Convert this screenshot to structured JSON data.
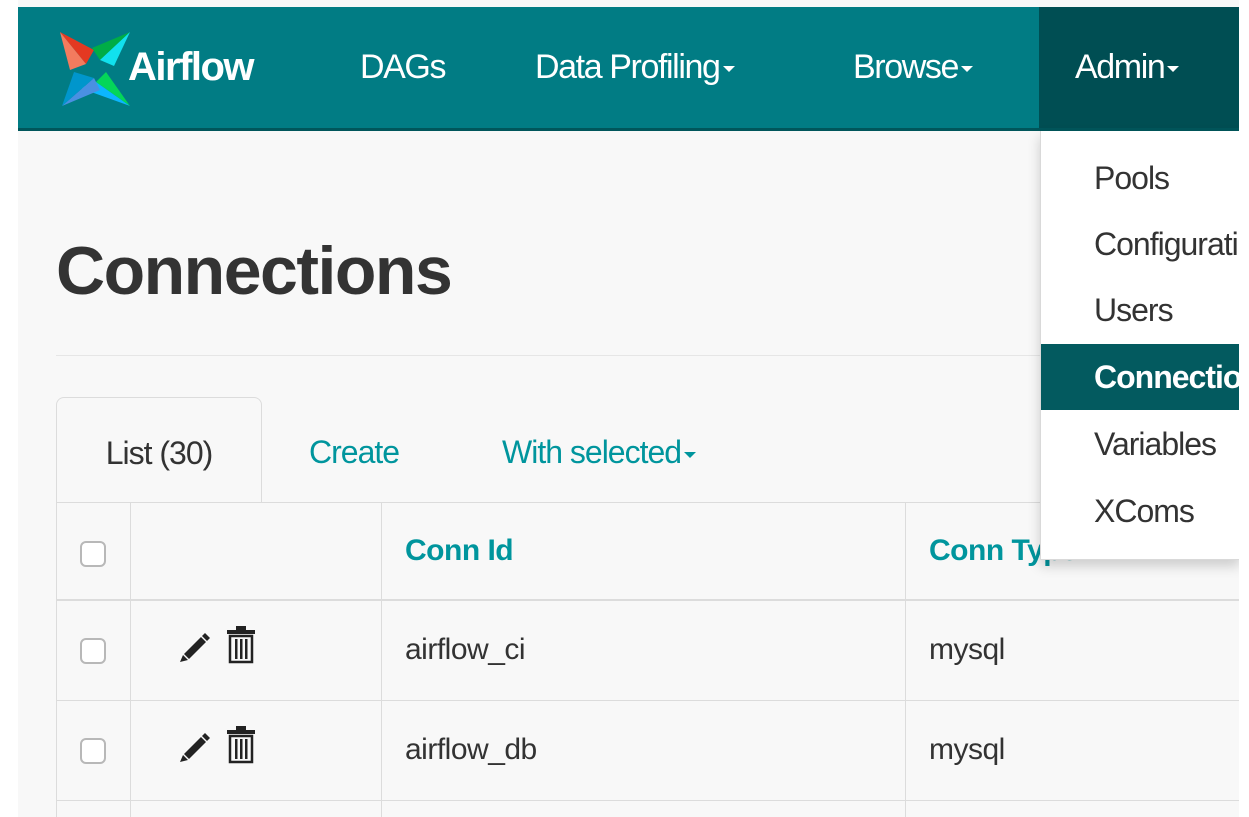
{
  "navbar": {
    "brand": "Airflow",
    "items": [
      {
        "label": "DAGs",
        "has_caret": false
      },
      {
        "label": "Data Profiling",
        "has_caret": true
      },
      {
        "label": "Browse",
        "has_caret": true
      },
      {
        "label": "Admin",
        "has_caret": true,
        "active": true
      }
    ]
  },
  "admin_menu": {
    "items": [
      {
        "label": "Pools"
      },
      {
        "label": "Configuration"
      },
      {
        "label": "Users"
      },
      {
        "label": "Connections",
        "active": true
      },
      {
        "label": "Variables"
      },
      {
        "label": "XComs"
      }
    ]
  },
  "page": {
    "title": "Connections"
  },
  "tabs": {
    "list": "List (30)",
    "create": "Create",
    "with_selected": "With selected"
  },
  "table": {
    "columns": [
      "Conn Id",
      "Conn Type"
    ],
    "rows": [
      {
        "conn_id": "airflow_ci",
        "conn_type": "mysql"
      },
      {
        "conn_id": "airflow_db",
        "conn_type": "mysql"
      }
    ]
  },
  "icons": [
    "airflow-logo-icon",
    "caret-down-icon",
    "pencil-icon",
    "trash-icon"
  ],
  "colors": {
    "navbar": "#017c84",
    "navbar_active": "#004e53",
    "link": "#00959d",
    "menu_active": "#035a5f",
    "page_bg": "#f8f8f8"
  }
}
